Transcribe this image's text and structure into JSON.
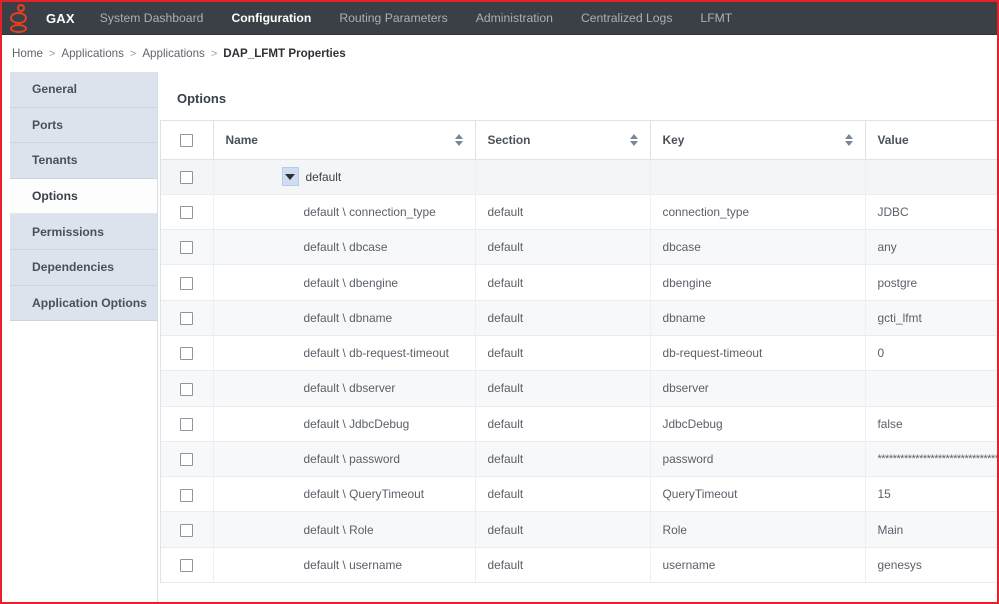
{
  "brand": {
    "name": "GAX",
    "logo_icon": "genesys-logo-icon",
    "accent_color": "#e8401f",
    "frame_color": "#e8202a",
    "nav_background": "#3b4047"
  },
  "topnav": {
    "items": [
      {
        "label": "System Dashboard",
        "active": false
      },
      {
        "label": "Configuration",
        "active": true
      },
      {
        "label": "Routing Parameters",
        "active": false
      },
      {
        "label": "Administration",
        "active": false
      },
      {
        "label": "Centralized Logs",
        "active": false
      },
      {
        "label": "LFMT",
        "active": false
      }
    ]
  },
  "breadcrumb": {
    "separator": ">",
    "items": [
      {
        "label": "Home",
        "current": false
      },
      {
        "label": "Applications",
        "current": false
      },
      {
        "label": "Applications",
        "current": false
      },
      {
        "label": "DAP_LFMT Properties",
        "current": true
      }
    ]
  },
  "sidebar": {
    "items": [
      {
        "label": "General",
        "active": false
      },
      {
        "label": "Ports",
        "active": false
      },
      {
        "label": "Tenants",
        "active": false
      },
      {
        "label": "Options",
        "active": true
      },
      {
        "label": "Permissions",
        "active": false
      },
      {
        "label": "Dependencies",
        "active": false
      },
      {
        "label": "Application Options",
        "active": false
      }
    ]
  },
  "main": {
    "panel_title": "Options",
    "table": {
      "select_all_checkbox": false,
      "columns": [
        {
          "label": "Name",
          "sortable": true,
          "sort_icon": "sort-arrows-icon"
        },
        {
          "label": "Section",
          "sortable": true,
          "sort_icon": "sort-arrows-icon"
        },
        {
          "label": "Key",
          "sortable": true,
          "sort_icon": "sort-arrows-icon"
        },
        {
          "label": "Value",
          "sortable": false,
          "sort_icon": ""
        }
      ],
      "group": {
        "label": "default",
        "expanded": true,
        "expander_icon": "caret-down-icon",
        "checked": false
      },
      "rows": [
        {
          "checked": false,
          "name": "default \\ connection_type",
          "section": "default",
          "key": "connection_type",
          "value": "JDBC"
        },
        {
          "checked": false,
          "name": "default \\ dbcase",
          "section": "default",
          "key": "dbcase",
          "value": "any"
        },
        {
          "checked": false,
          "name": "default \\ dbengine",
          "section": "default",
          "key": "dbengine",
          "value": "postgre"
        },
        {
          "checked": false,
          "name": "default \\ dbname",
          "section": "default",
          "key": "dbname",
          "value": "gcti_lfmt"
        },
        {
          "checked": false,
          "name": "default \\ db-request-timeout",
          "section": "default",
          "key": "db-request-timeout",
          "value": "0"
        },
        {
          "checked": false,
          "name": "default \\ dbserver",
          "section": "default",
          "key": "dbserver",
          "value": ""
        },
        {
          "checked": false,
          "name": "default \\ JdbcDebug",
          "section": "default",
          "key": "JdbcDebug",
          "value": "false"
        },
        {
          "checked": false,
          "name": "default \\ password",
          "section": "default",
          "key": "password",
          "value": "**********************************"
        },
        {
          "checked": false,
          "name": "default \\ QueryTimeout",
          "section": "default",
          "key": "QueryTimeout",
          "value": "15"
        },
        {
          "checked": false,
          "name": "default \\ Role",
          "section": "default",
          "key": "Role",
          "value": "Main"
        },
        {
          "checked": false,
          "name": "default \\ username",
          "section": "default",
          "key": "username",
          "value": "genesys"
        }
      ]
    }
  }
}
